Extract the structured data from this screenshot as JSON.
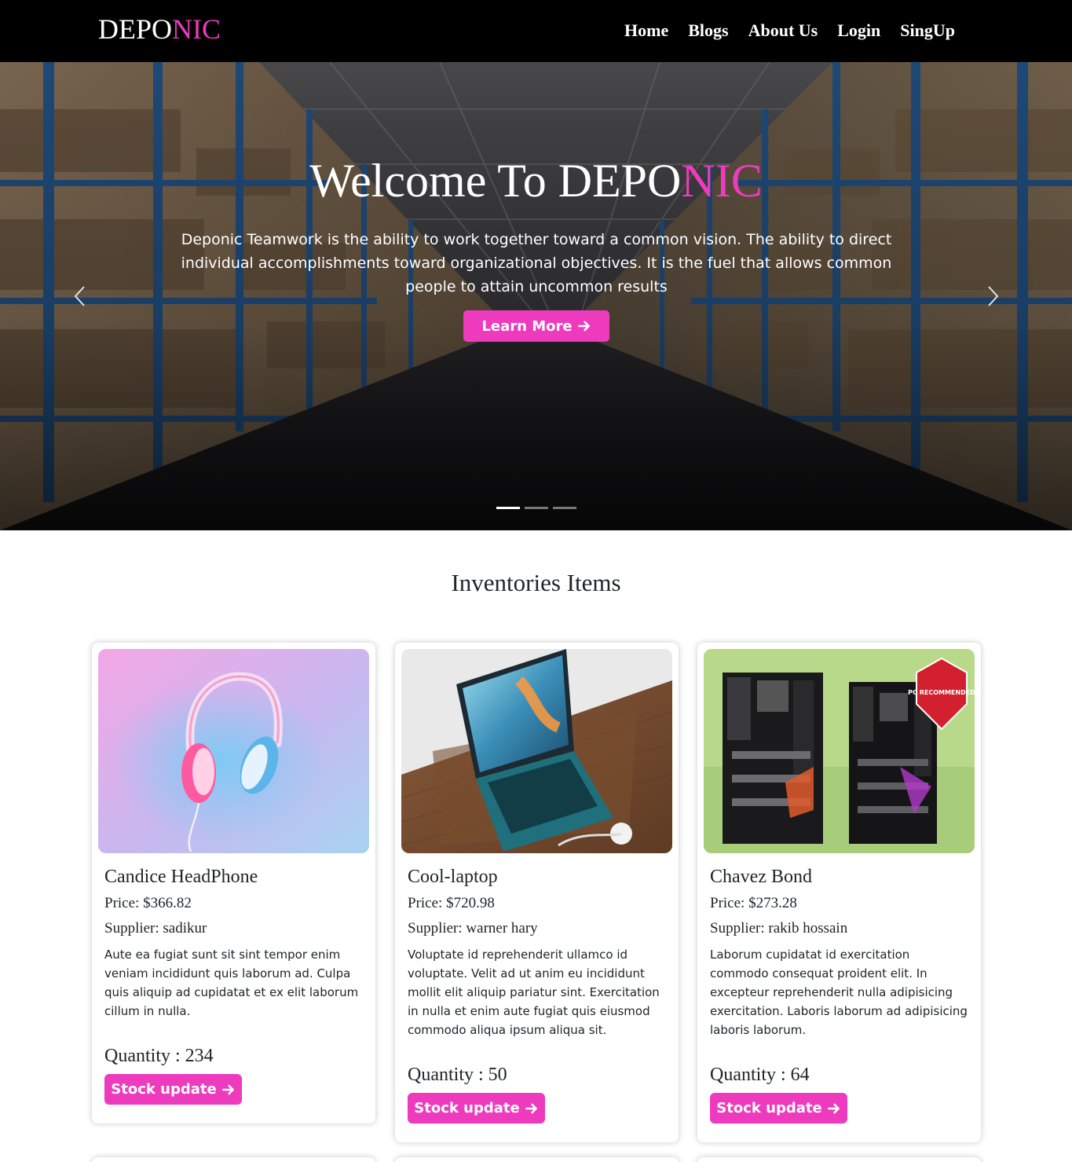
{
  "navbar": {
    "brand_main": "DEPO",
    "brand_accent": "NIC",
    "links": [
      "Home",
      "Blogs",
      "About Us",
      "Login",
      "SingUp"
    ]
  },
  "hero": {
    "title_main": "Welcome To DEPO",
    "title_accent": "NIC",
    "description": "Deponic Teamwork is the ability to work together toward a common vision. The ability to direct individual accomplishments toward organizational objectives. It is the fuel that allows common people to attain uncommon results",
    "button_label": "Learn More",
    "button_icon": "arrow-right-icon",
    "active_slide": 1,
    "slide_count": 3
  },
  "inventory": {
    "title": "Inventories Items",
    "button_label": "Stock update",
    "items": [
      {
        "name": "Candice HeadPhone",
        "price": "Price: $366.82",
        "supplier": "Supplier: sadikur",
        "description": "Aute ea fugiat sunt sit sint tempor enim veniam incididunt quis laborum ad. Culpa quis aliquip ad cupidatat et ex elit laborum cillum in nulla.",
        "quantity": "Quantity : 234"
      },
      {
        "name": "Cool-laptop",
        "price": "Price: $720.98",
        "supplier": "Supplier: warner hary",
        "description": "Voluptate id reprehenderit ullamco id voluptate. Velit ad ut anim eu incididunt mollit elit aliquip pariatur sint. Exercitation in nulla et enim aute fugiat quis eiusmod commodo aliqua ipsum aliqua sit.",
        "quantity": "Quantity : 50"
      },
      {
        "name": "Chavez Bond",
        "price": "Price: $273.28",
        "supplier": "Supplier: rakib hossain",
        "description": "Laborum cupidatat id exercitation commodo consequat proident elit. In excepteur reprehenderit nulla adipisicing exercitation. Laboris laborum ad adipisicing laboris laborum.",
        "quantity": "Quantity : 64",
        "badge_text": "PC RECOMMENDED"
      }
    ]
  },
  "colors": {
    "accent": "#ee3bbd",
    "navbar_bg": "#000000",
    "text": "#212529"
  }
}
